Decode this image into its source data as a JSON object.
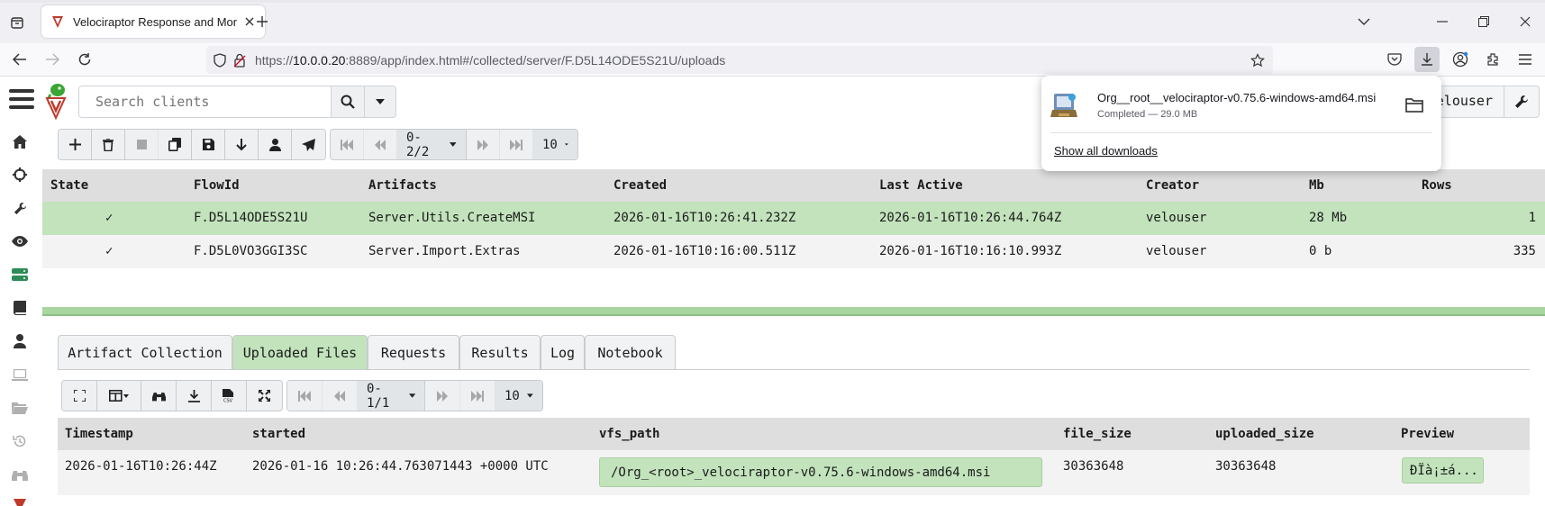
{
  "browser": {
    "tab_title": "Velociraptor Response and Mon",
    "url_prefix": "https://",
    "url_host": "10.0.0.20",
    "url_rest": ":8889/app/index.html#/collected/server/F.D5L14ODE5S21U/uploads"
  },
  "header": {
    "search_placeholder": "Search clients",
    "user": "elouser"
  },
  "flows_toolbar": {
    "pager": "0-2/2",
    "page_size": "10"
  },
  "flows_table": {
    "columns": [
      "State",
      "FlowId",
      "Artifacts",
      "Created",
      "Last Active",
      "Creator",
      "Mb",
      "Rows"
    ],
    "rows": [
      {
        "state": "✓",
        "flow_id": "F.D5L14ODE5S21U",
        "artifact": "Server.Utils.CreateMSI",
        "created": "2026-01-16T10:26:41.232Z",
        "last_active": "2026-01-16T10:26:44.764Z",
        "creator": "velouser",
        "mb": "28 Mb",
        "rows": "1"
      },
      {
        "state": "✓",
        "flow_id": "F.D5L0VO3GGI3SC",
        "artifact": "Server.Import.Extras",
        "created": "2026-01-16T10:16:00.511Z",
        "last_active": "2026-01-16T10:16:10.993Z",
        "creator": "velouser",
        "mb": "0 b",
        "rows": "335"
      }
    ]
  },
  "subtabs": [
    "Artifact Collection",
    "Uploaded Files",
    "Requests",
    "Results",
    "Log",
    "Notebook"
  ],
  "uploads_toolbar": {
    "pager": "0-1/1",
    "page_size": "10"
  },
  "uploads_table": {
    "columns": [
      "Timestamp",
      "started",
      "vfs_path",
      "file_size",
      "uploaded_size",
      "Preview"
    ],
    "rows": [
      {
        "timestamp": "2026-01-16T10:26:44Z",
        "started": "2026-01-16 10:26:44.763071443 +0000 UTC",
        "vfs_path": "/Org_<root>_velociraptor-v0.75.6-windows-amd64.msi",
        "file_size": "30363648",
        "uploaded_size": "30363648",
        "preview": "ÐÏà¡±á..."
      }
    ]
  },
  "downloads": {
    "file_name": "Org__root__velociraptor-v0.75.6-windows-amd64.msi",
    "status": "Completed — 29.0 MB",
    "show_all": "Show all downloads"
  },
  "colors": {
    "selected_row": "#c2e3bc",
    "splitter": "#a8d5a0",
    "header_bg": "#dedede"
  }
}
